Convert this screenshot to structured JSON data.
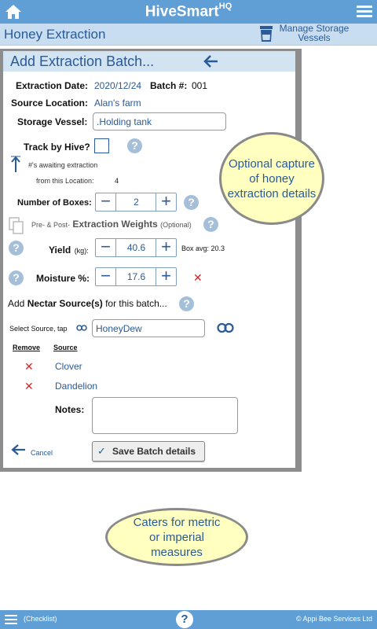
{
  "topbar": {
    "title": "HiveSmart",
    "title_sup": "HQ"
  },
  "subheader": {
    "page_title": "Honey Extraction",
    "manage_label": "Manage Storage Vessels"
  },
  "panel": {
    "title": "Add Extraction Batch...",
    "extraction_date_label": "Extraction Date:",
    "extraction_date_value": "2020/12/24",
    "batch_label": "Batch #:",
    "batch_value": "001",
    "source_location_label": "Source Location:",
    "source_location_value": "Alan's farm",
    "storage_vessel_label": "Storage Vessel:",
    "storage_vessel_value": ".Holding tank",
    "track_by_hive_label": "Track by Hive?",
    "awaiting_label": "#'s awaiting extraction",
    "from_location_label": "from this Location:",
    "from_location_value": "4",
    "boxes_label": "Number of Boxes:",
    "boxes_value": "2",
    "weights_prefix": "Pre- & Post-",
    "weights_label": "Extraction Weights",
    "weights_suffix": "(Optional)",
    "yield_label": "Yield",
    "yield_unit": "(kg):",
    "yield_value": "40.6",
    "box_avg": "Box avg: 20.3",
    "moisture_label": "Moisture %:",
    "moisture_value": "17.6",
    "nectar_prefix": "Add",
    "nectar_label": "Nectar Source(s)",
    "nectar_suffix": "for this batch...",
    "select_source_label": "Select Source, tap",
    "source_input_value": "HoneyDew",
    "remove_header": "Remove",
    "source_header": "Source",
    "sources": [
      "Clover",
      "Dandelion"
    ],
    "notes_label": "Notes:",
    "notes_value": "",
    "cancel_label": "Cancel",
    "save_label": "Save Batch details"
  },
  "callouts": {
    "optional": "Optional capture of honey extraction details",
    "measures": "Caters for metric or imperial measures"
  },
  "footer": {
    "checklist": "(Checklist)",
    "copyright": "© Appi Bee Services Ltd"
  },
  "colors": {
    "header_blue": "#5f9fd6",
    "link_blue": "#2a5a98",
    "callout_yellow": "#ffffc0"
  }
}
